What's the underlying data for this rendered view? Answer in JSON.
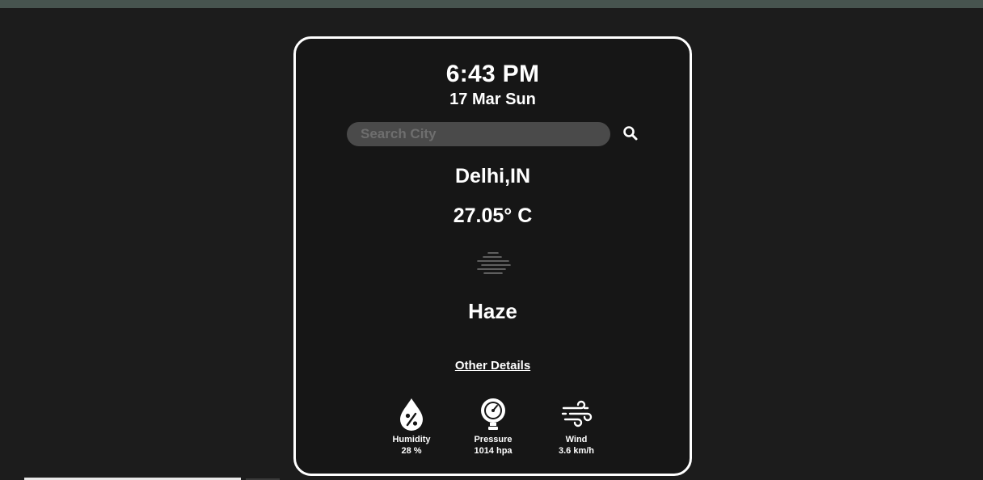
{
  "clock": {
    "time": "6:43 PM",
    "date": "17 Mar Sun"
  },
  "search": {
    "placeholder": "Search City",
    "value": "",
    "icon": "search-icon"
  },
  "weather": {
    "city": "Delhi,IN",
    "temperature": "27.05° C",
    "condition": "Haze",
    "condition_icon": "haze-icon"
  },
  "other_details_link": "Other Details",
  "details": {
    "humidity": {
      "label": "Humidity",
      "value": "28 %",
      "icon": "humidity-icon"
    },
    "pressure": {
      "label": "Pressure",
      "value": "1014 hpa",
      "icon": "pressure-gauge-icon"
    },
    "wind": {
      "label": "Wind",
      "value": "3.6 km/h",
      "icon": "wind-icon"
    }
  },
  "colors": {
    "background": "#1c1c1c",
    "card": "#161616",
    "card_border": "#ffffff",
    "search_field": "#4a4a4a",
    "top_strip": "#47544f"
  }
}
